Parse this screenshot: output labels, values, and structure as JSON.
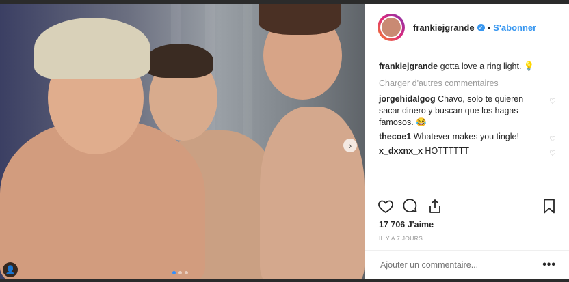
{
  "post": {
    "username": "frankiejgrande",
    "separator": "•",
    "follow_label": "S'abonner",
    "caption_user": "frankiejgrande",
    "caption_text": " gotta love a ring light. 💡",
    "load_more": "Charger d'autres commentaires",
    "comments": [
      {
        "user": "jorgehidalgog",
        "text": " Chavo, solo te quieren sacar dinero y buscan que los hagas famosos. 😂"
      },
      {
        "user": "thecoe1",
        "text": " Whatever makes you tingle!"
      },
      {
        "user": "x_dxxnx_x",
        "text": " HOTTTTTT"
      }
    ],
    "likes": "17 706 J'aime",
    "timestamp": "IL Y A 7 JOURS",
    "add_comment_placeholder": "Ajouter un commentaire...",
    "more_label": "•••",
    "carousel": {
      "slides": 3,
      "active": 1
    },
    "next_glyph": "›",
    "verified_glyph": "✓",
    "tag_glyph": "👤",
    "heart_glyph": "♡"
  },
  "icons": [
    "heart-icon",
    "comment-icon",
    "share-icon",
    "bookmark-icon",
    "verified-icon",
    "chevron-right-icon",
    "user-tag-icon"
  ],
  "colors": {
    "link": "#3897f0",
    "text": "#262626",
    "muted": "#999999",
    "border": "#efefef"
  }
}
